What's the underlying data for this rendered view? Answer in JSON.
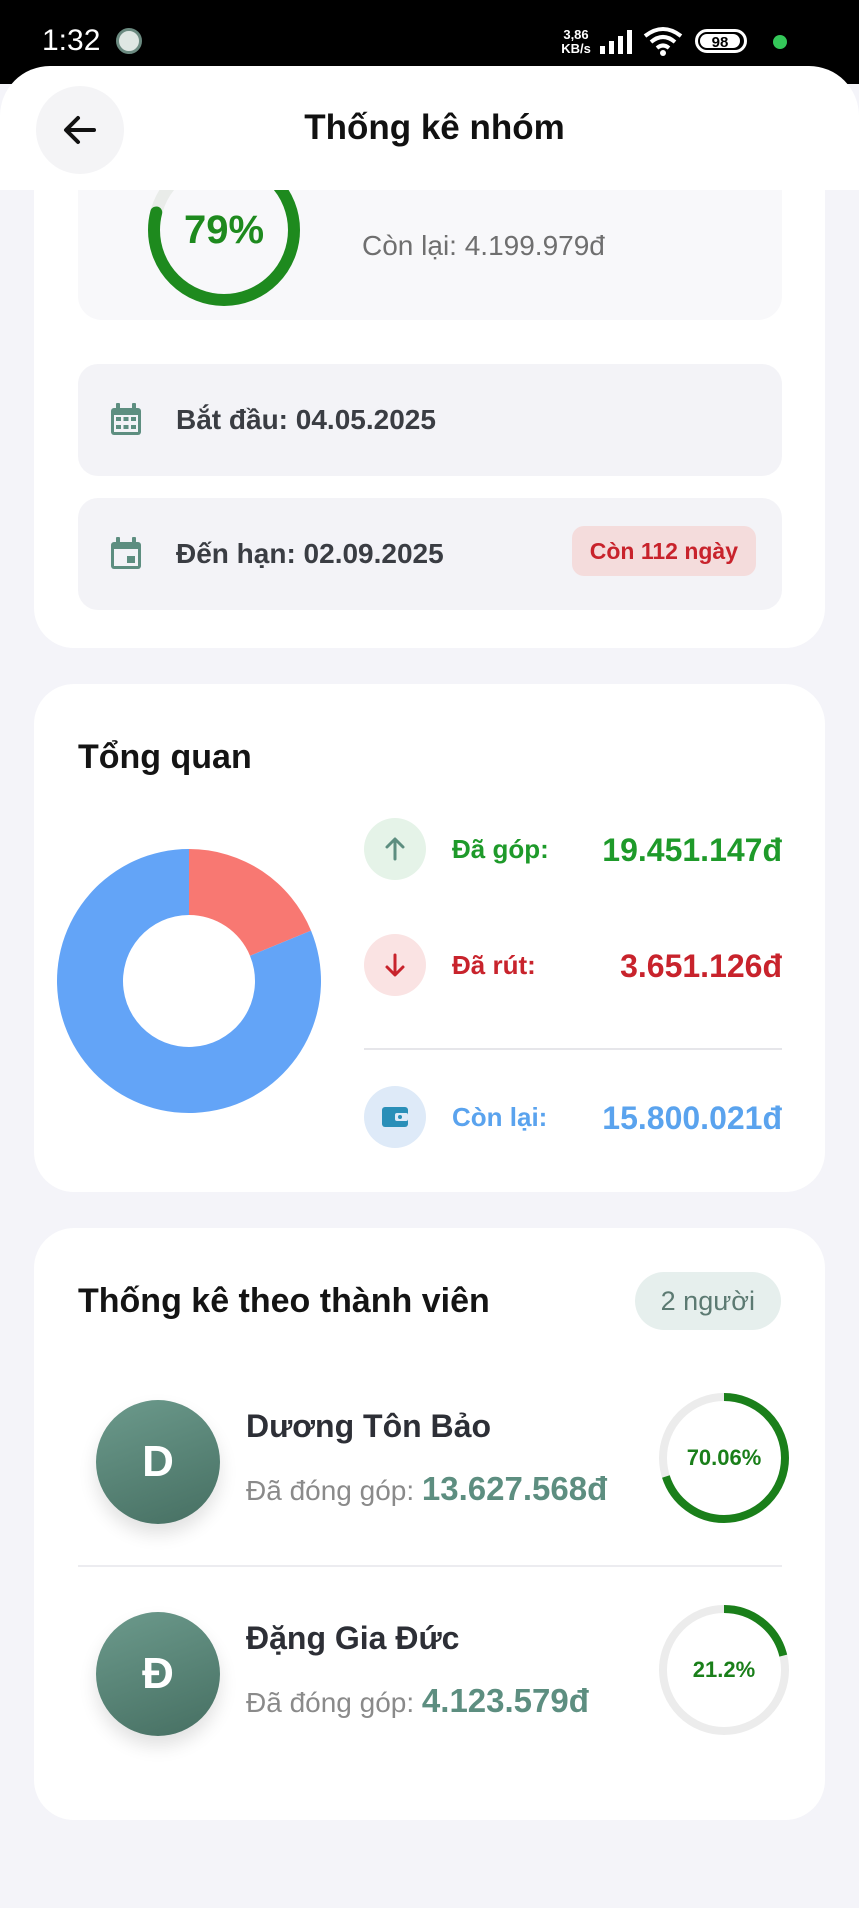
{
  "status_bar": {
    "time": "1:32",
    "net_speed_value": "3,86",
    "net_speed_unit": "KB/s",
    "battery": "98"
  },
  "header": {
    "title": "Thống kê nhóm",
    "back_icon": "arrow-left-icon"
  },
  "progress": {
    "percent_label": "79%",
    "percent": 79,
    "remaining": "Còn lại: 4.199.979đ",
    "color": "#1e8a1e"
  },
  "dates": {
    "start": "Bắt đầu: 04.05.2025",
    "due": "Đến hạn: 02.09.2025",
    "days_left": "Còn 112 ngày"
  },
  "overview": {
    "title": "Tổng quan",
    "contributed_label": "Đã góp:",
    "contributed_value": "19.451.147đ",
    "withdrawn_label": "Đã rút:",
    "withdrawn_value": "3.651.126đ",
    "remaining_label": "Còn lại:",
    "remaining_value": "15.800.021đ",
    "colors": {
      "contributed": "#1e9a2a",
      "withdrawn": "#c8232c",
      "remaining": "#5aa3ee"
    }
  },
  "chart_data": {
    "type": "pie",
    "categories": [
      "Đã rút",
      "Còn lại"
    ],
    "values": [
      3651126,
      15800021
    ],
    "colors": [
      "#f87872",
      "#63a4f7"
    ]
  },
  "members": {
    "title": "Thống kê theo thành viên",
    "count": "2 người",
    "contrib_label": "Đã đóng góp:",
    "list": [
      {
        "initial": "D",
        "name": "Dương Tôn Bảo",
        "amount": "13.627.568đ",
        "percent_label": "70.06%",
        "percent": 70.06
      },
      {
        "initial": "Đ",
        "name": "Đặng Gia Đức",
        "amount": "4.123.579đ",
        "percent_label": "21.2%",
        "percent": 21.2
      }
    ]
  }
}
